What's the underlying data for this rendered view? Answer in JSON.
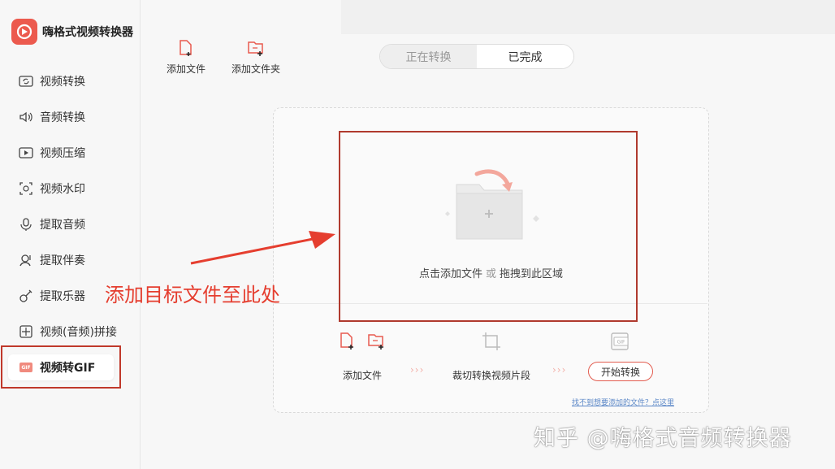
{
  "app": {
    "title": "嗨格式视频转换器"
  },
  "sidebar": {
    "items": [
      {
        "label": "视频转换",
        "icon": "video-convert-icon"
      },
      {
        "label": "音频转换",
        "icon": "audio-convert-icon"
      },
      {
        "label": "视频压缩",
        "icon": "video-compress-icon"
      },
      {
        "label": "视频水印",
        "icon": "video-watermark-icon"
      },
      {
        "label": "提取音频",
        "icon": "extract-audio-icon"
      },
      {
        "label": "提取伴奏",
        "icon": "extract-accompaniment-icon"
      },
      {
        "label": "提取乐器",
        "icon": "extract-instrument-icon"
      },
      {
        "label": "视频(音频)拼接",
        "icon": "merge-icon"
      },
      {
        "label": "视频转GIF",
        "icon": "gif-icon",
        "active": true
      }
    ]
  },
  "toolbar": {
    "add_file": "添加文件",
    "add_folder": "添加文件夹"
  },
  "tabs": {
    "converting": "正在转换",
    "completed": "已完成"
  },
  "dropzone": {
    "text_click": "点击添加文件",
    "text_or": "或",
    "text_drag": "拖拽到此区域"
  },
  "steps": {
    "add_file": "添加文件",
    "crop": "裁切转换视频片段",
    "start": "开始转换",
    "gif_badge": "GIF"
  },
  "help_link": "找不到想要添加的文件？点这里",
  "annotation": "添加目标文件至此处",
  "watermark": "知乎 @嗨格式音频转换器",
  "colors": {
    "accent": "#e85a4f",
    "annotation_red": "#e53e2f",
    "link": "#5b87c7"
  }
}
